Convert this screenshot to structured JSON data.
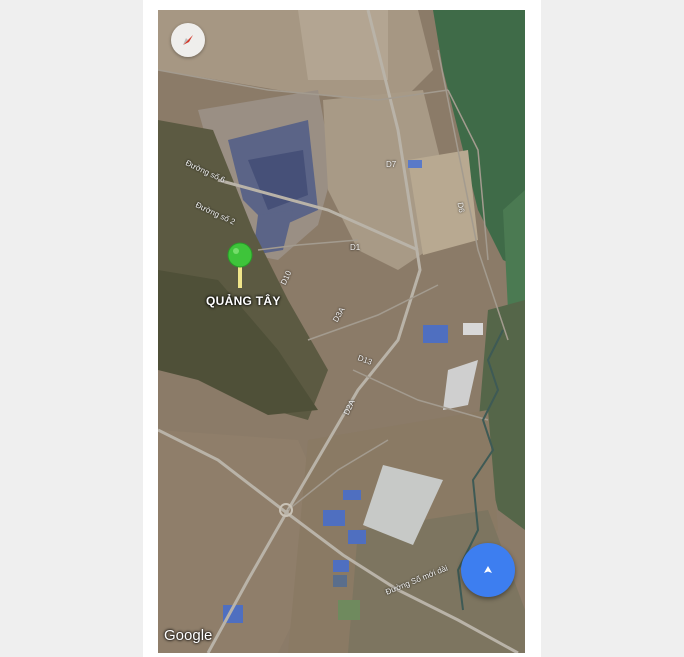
{
  "map": {
    "place_label": "QUẢNG TÂY",
    "attribution": "Google",
    "roads": {
      "d7": "D7",
      "d6": "D6",
      "d1": "D1",
      "d10": "D10",
      "d3a": "D3A",
      "d13": "D13",
      "d2a": "D2A",
      "duong_so_6": "Đường số 6",
      "duong_so_2": "Đường số 2",
      "duong_so_moi": "Đường Số mới dài"
    }
  },
  "controls": {
    "compass": {
      "icon": "compass-icon"
    },
    "locate": {
      "icon": "navigation-arrow-icon",
      "color": "#3d7ef0"
    }
  },
  "pin": {
    "color": "#3ec43a",
    "stem_color": "#f0e58a"
  }
}
